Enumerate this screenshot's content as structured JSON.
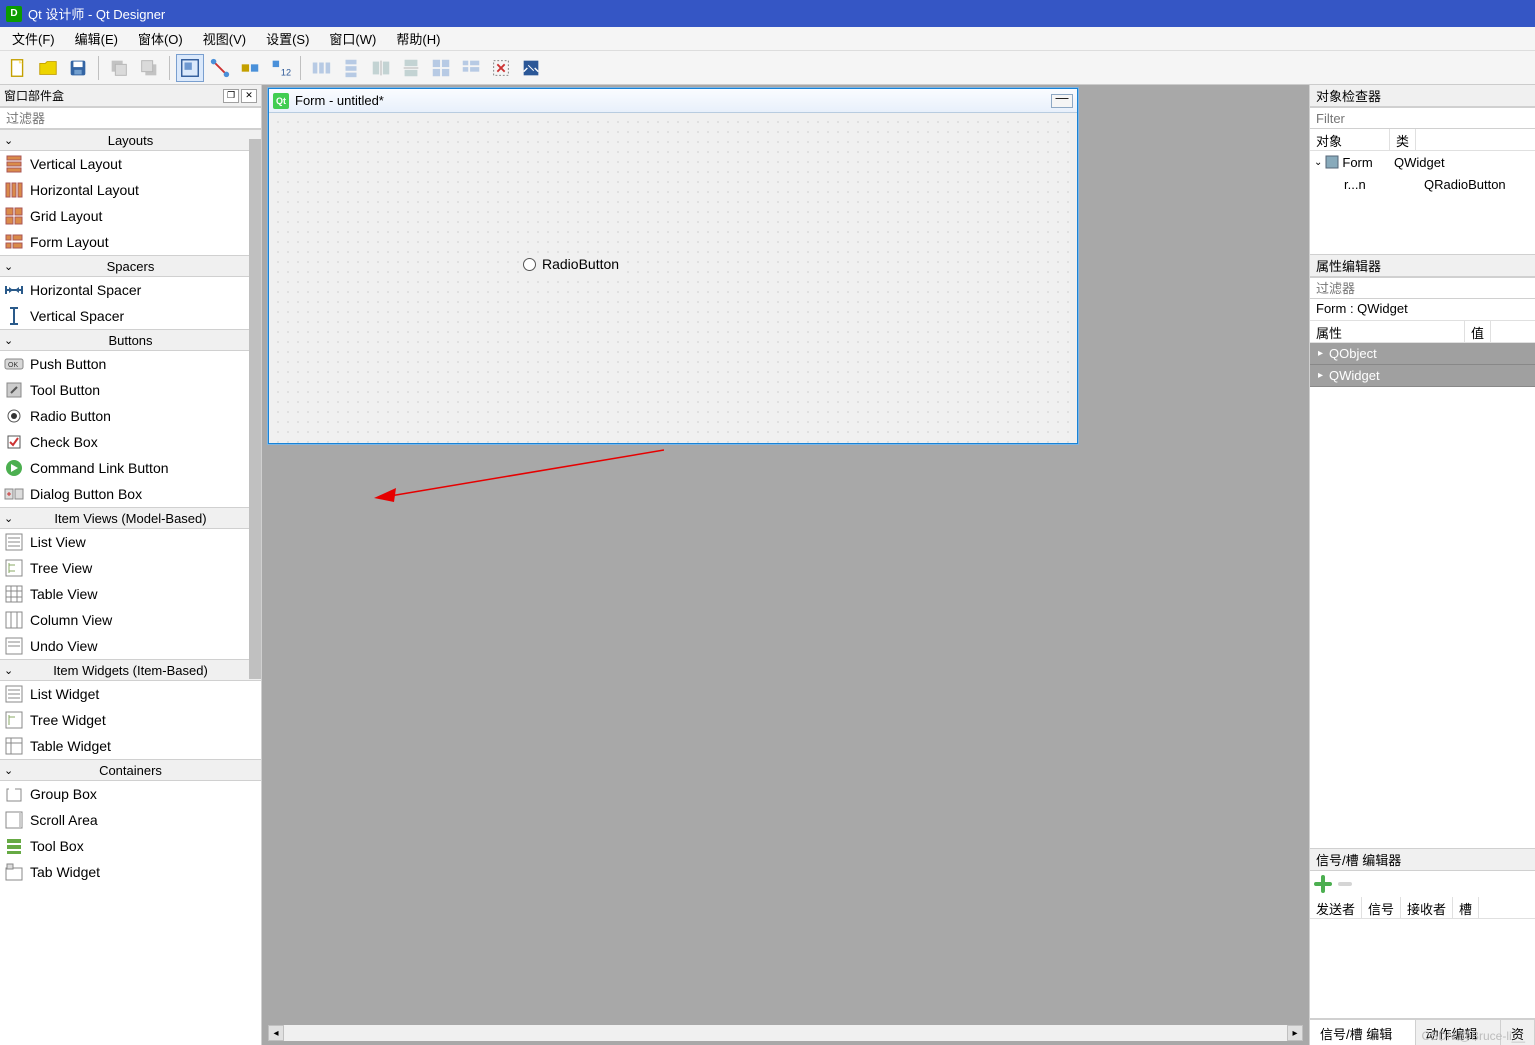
{
  "title": "Qt 设计师 - Qt Designer",
  "menus": [
    "文件(F)",
    "编辑(E)",
    "窗体(O)",
    "视图(V)",
    "设置(S)",
    "窗口(W)",
    "帮助(H)"
  ],
  "widget_box": {
    "title": "窗口部件盒",
    "filter_placeholder": "过滤器",
    "groups": [
      {
        "name": "Layouts",
        "items": [
          "Vertical Layout",
          "Horizontal Layout",
          "Grid Layout",
          "Form Layout"
        ]
      },
      {
        "name": "Spacers",
        "items": [
          "Horizontal Spacer",
          "Vertical Spacer"
        ]
      },
      {
        "name": "Buttons",
        "items": [
          "Push Button",
          "Tool Button",
          "Radio Button",
          "Check Box",
          "Command Link Button",
          "Dialog Button Box"
        ]
      },
      {
        "name": "Item Views (Model-Based)",
        "items": [
          "List View",
          "Tree View",
          "Table View",
          "Column View",
          "Undo View"
        ]
      },
      {
        "name": "Item Widgets (Item-Based)",
        "items": [
          "List Widget",
          "Tree Widget",
          "Table Widget"
        ]
      },
      {
        "name": "Containers",
        "items": [
          "Group Box",
          "Scroll Area",
          "Tool Box",
          "Tab Widget"
        ]
      }
    ]
  },
  "form": {
    "title": "Form - untitled*",
    "radio_label": "RadioButton"
  },
  "object_inspector": {
    "title": "对象检查器",
    "filter_placeholder": "Filter",
    "cols": [
      "对象",
      "类"
    ],
    "rows": [
      {
        "name": "Form",
        "class": "QWidget",
        "indent": 0
      },
      {
        "name": "r...n",
        "class": "QRadioButton",
        "indent": 1
      }
    ]
  },
  "property_editor": {
    "title": "属性编辑器",
    "filter_placeholder": "过滤器",
    "context": "Form : QWidget",
    "cols": [
      "属性",
      "值"
    ],
    "groups": [
      "QObject",
      "QWidget"
    ]
  },
  "signal_editor": {
    "title": "信号/槽 编辑器",
    "cols": [
      "发送者",
      "信号",
      "接收者",
      "槽"
    ]
  },
  "right_tabs": [
    "信号/槽 编辑器",
    "动作编辑器",
    "资"
  ],
  "watermark": "CSDN @Bruce-li__"
}
